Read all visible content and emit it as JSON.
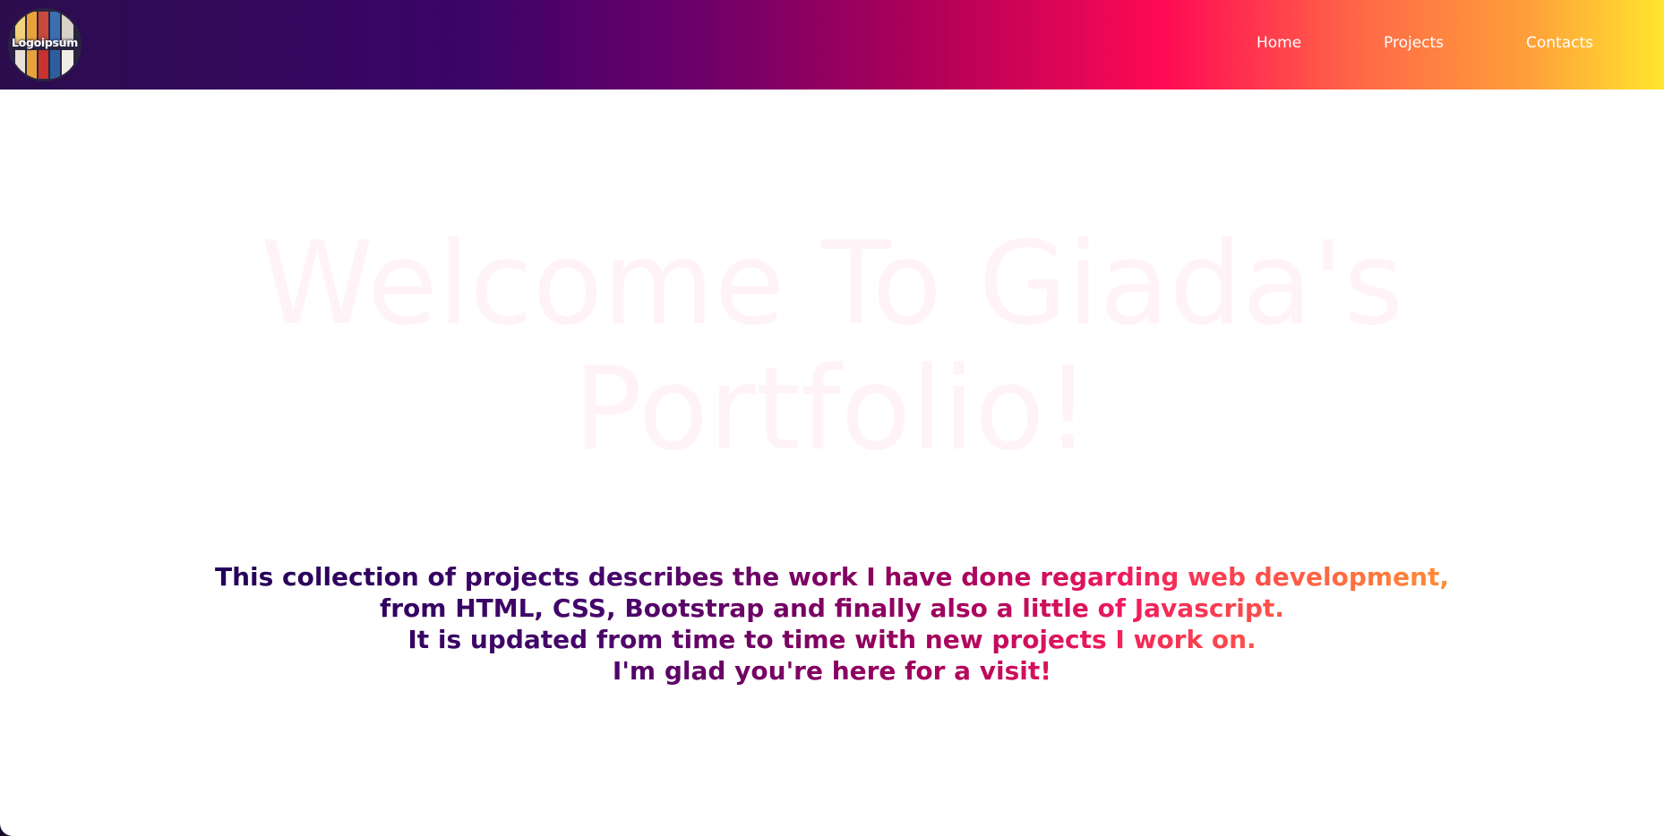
{
  "logo": {
    "text": "Logoipsum"
  },
  "nav": {
    "home_label": "Home",
    "projects_label": "Projects",
    "contacts_label": "Contacts"
  },
  "hero": {
    "line1": "Welcome To Giada's",
    "line2": "Portfolio!"
  },
  "intro": {
    "lines": [
      "This collection of projects describes the work I have done regarding web development,",
      "from HTML, CSS, Bootstrap and finally also a little of Javascript.",
      "It is updated from time to time with new projects I work on.",
      "I'm glad you're here for a visit!"
    ]
  },
  "colors": {
    "nav_gradient": [
      "#2b0d4d",
      "#3b0468",
      "#b20058",
      "#ff0a54",
      "#ffa03a",
      "#ffe62f"
    ],
    "hero_text": "#fff3f8",
    "intro_gradient": [
      "#240058",
      "#9a005e",
      "#f01a5c",
      "#ffa42f"
    ]
  }
}
